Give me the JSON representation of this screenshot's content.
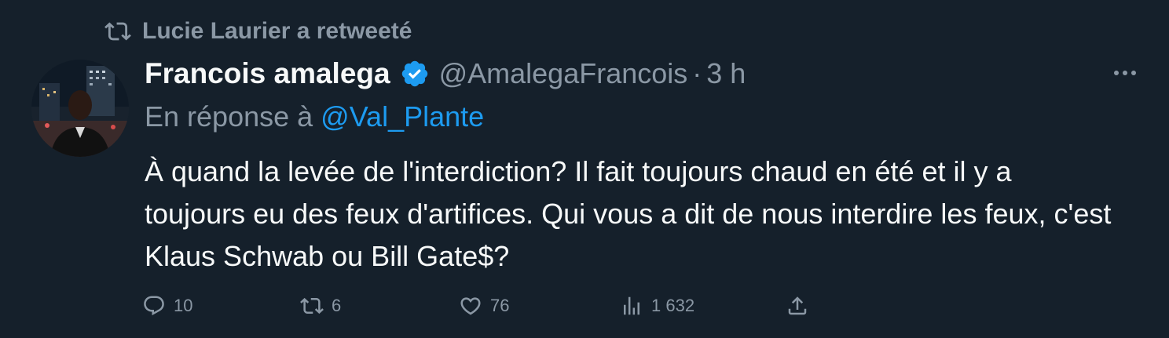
{
  "retweet_context": {
    "text": "Lucie Laurier a retweeté",
    "icon": "retweet-icon"
  },
  "author": {
    "display_name": "Francois amalega",
    "handle": "@AmalegaFrancois",
    "verified": true,
    "verified_color": "#1d9bf0",
    "time": "3 h",
    "separator": "·"
  },
  "reply_context": {
    "prefix": "En réponse à",
    "handle": "@Val_Plante"
  },
  "tweet": {
    "text": "À quand la levée de l'interdiction? Il fait toujours chaud en été et il y a toujours eu des feux d'artifices. Qui vous a dit de nous interdire les feux, c'est Klaus Schwab ou Bill Gate$?"
  },
  "actions": {
    "replies": "10",
    "retweets": "6",
    "likes": "76",
    "views": "1 632"
  },
  "colors": {
    "background": "#15202b",
    "primary_text": "#f7f9f9",
    "secondary_text": "#8b98a5",
    "link": "#1d9bf0"
  }
}
